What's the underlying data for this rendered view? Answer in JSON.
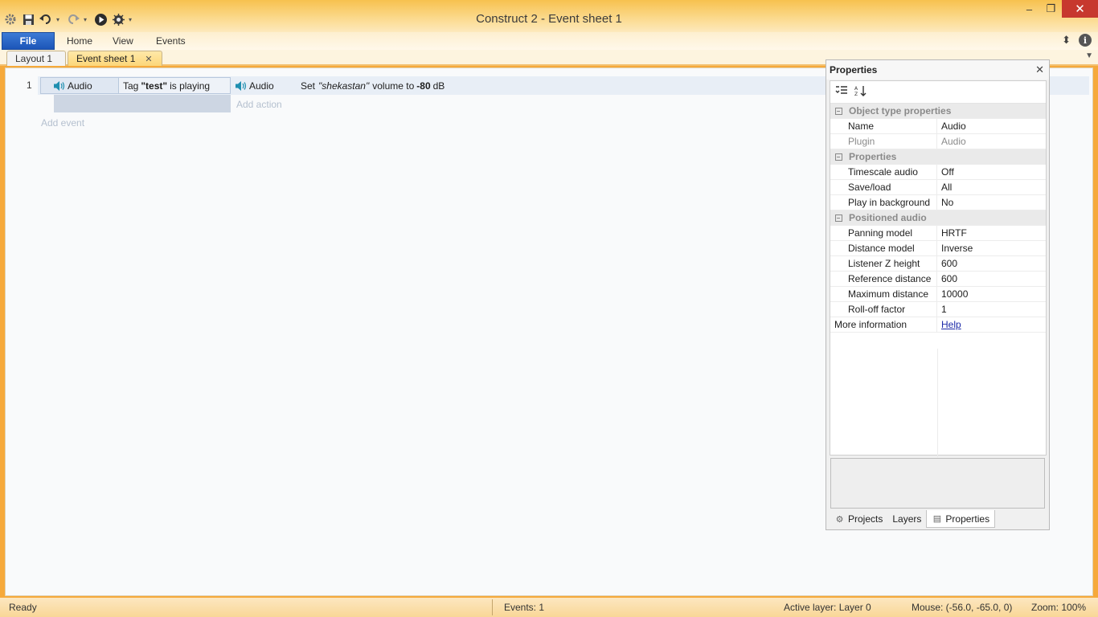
{
  "window": {
    "title": "Construct 2 - Event sheet 1",
    "minimize": "–",
    "restore": "❐",
    "close": "✕"
  },
  "quick_access": {
    "app_icon": "gear-icon",
    "save": "save-icon",
    "undo": "undo-icon",
    "redo": "redo-icon",
    "preview": "play-icon",
    "debug": "debug-icon"
  },
  "ribbon": {
    "tabs": [
      "File",
      "Home",
      "View",
      "Events"
    ],
    "info_label": "i",
    "updown_label": "⬍"
  },
  "doc_tabs": [
    {
      "label": "Layout 1"
    },
    {
      "label": "Event sheet 1",
      "close": "✕"
    }
  ],
  "event_sheet": {
    "events": [
      {
        "number": "1",
        "condition_object": "Audio",
        "condition_prefix": "Tag",
        "condition_tag": "\"test\"",
        "condition_suffix": "is playing",
        "action_object": "Audio",
        "action_prefix": "Set",
        "action_tag": "\"shekastan\"",
        "action_mid": "volume to",
        "action_value": "-80",
        "action_unit": "dB"
      }
    ],
    "add_action": "Add action",
    "add_event": "Add event"
  },
  "properties_panel": {
    "title": "Properties",
    "close": "✕",
    "groups": [
      {
        "name": "Object type properties",
        "rows": [
          {
            "key": "Name",
            "value": "Audio"
          },
          {
            "key": "Plugin",
            "value": "Audio"
          }
        ]
      },
      {
        "name": "Properties",
        "rows": [
          {
            "key": "Timescale audio",
            "value": "Off"
          },
          {
            "key": "Save/load",
            "value": "All"
          },
          {
            "key": "Play in background",
            "value": "No"
          }
        ]
      },
      {
        "name": "Positioned audio",
        "rows": [
          {
            "key": "Panning model",
            "value": "HRTF"
          },
          {
            "key": "Distance model",
            "value": "Inverse"
          },
          {
            "key": "Listener Z height",
            "value": "600"
          },
          {
            "key": "Reference distance",
            "value": "600"
          },
          {
            "key": "Maximum distance",
            "value": "10000"
          },
          {
            "key": "Roll-off factor",
            "value": "1"
          }
        ]
      }
    ],
    "more_info_key": "More information",
    "more_info_link": "Help",
    "bottom_tabs": [
      "Projects",
      "Layers",
      "Properties"
    ]
  },
  "status_bar": {
    "state": "Ready",
    "events": "Events: 1",
    "active_layer": "Active layer: Layer 0",
    "mouse": "Mouse: (-56.0, -65.0, 0)",
    "zoom": "Zoom: 100%"
  },
  "colors": {
    "title_gradient_top": "#f7c14f",
    "file_tab": "#1c55b8",
    "close_button": "#c7382e",
    "event_row": "#e8eef6",
    "link": "#1c2aa8"
  }
}
